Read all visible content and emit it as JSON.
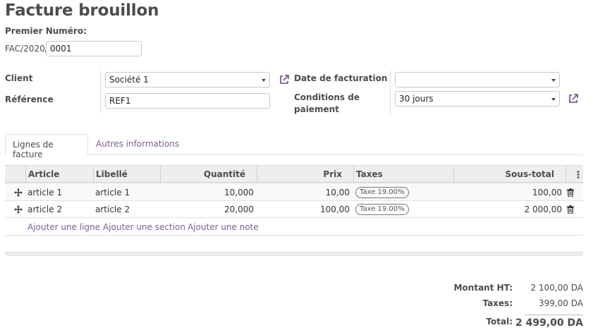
{
  "header": {
    "title": "Facture brouillon"
  },
  "numbering": {
    "label": "Premier Numéro:",
    "prefix": "FAC/2020/",
    "value": "0001"
  },
  "form": {
    "client_label": "Client",
    "client_value": "Société 1",
    "reference_label": "Référence",
    "reference_value": "REF1",
    "invoice_date_label": "Date de facturation",
    "invoice_date_value": "",
    "payment_terms_label_line1": "Conditions de",
    "payment_terms_label_line2": "paiement",
    "payment_terms_value": "30 jours"
  },
  "tabs": [
    {
      "label": "Lignes de facture",
      "active": true
    },
    {
      "label": "Autres informations",
      "active": false
    }
  ],
  "table": {
    "headers": [
      "Article",
      "Libellé",
      "Quantité",
      "Prix",
      "Taxes",
      "Sous-total"
    ],
    "rows": [
      {
        "article": "article 1",
        "libelle": "article 1",
        "quantite": "10,000",
        "prix": "10,00",
        "taxe": "Taxe 19.00%",
        "sous_total": "100,00"
      },
      {
        "article": "article 2",
        "libelle": "article 2",
        "quantite": "20,000",
        "prix": "100,00",
        "taxe": "Taxe 19.00%",
        "sous_total": "2 000,00"
      }
    ],
    "add_links": [
      "Ajouter une ligne",
      "Ajouter une section",
      "Ajouter une note"
    ]
  },
  "totals": {
    "ht_label": "Montant HT:",
    "ht_value": "2 100,00 DA",
    "taxes_label": "Taxes:",
    "taxes_value": "399,00 DA",
    "total_label": "Total:",
    "total_value": "2 499,00 DA"
  },
  "icons": {
    "external_link": "external-link-icon",
    "drag_handle": "drag-handle-icon",
    "trash": "trash-icon",
    "column_options": "column-options-icon"
  },
  "colors": {
    "accent": "#7c5d95",
    "text": "#4c4c4c",
    "header_bg": "#eeeeee"
  }
}
